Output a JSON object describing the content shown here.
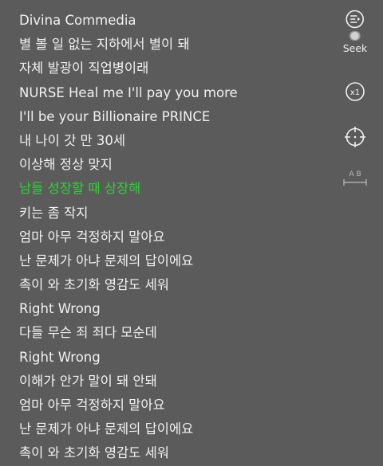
{
  "lyrics": {
    "current_index": 7,
    "lines": [
      "Divina Commedia",
      "별 볼 일 없는 지하에서 별이 돼",
      "자체 발광이 직업병이래",
      "NURSE Heal me I'll pay you more",
      "I'll be your Billionaire PRINCE",
      "내 나이 갓 만 30세",
      "이상해 정상 맞지",
      "남들 성장할 때 상장해",
      "키는 좀 작지",
      "엄마 아무 걱정하지 말아요",
      "난 문제가 아냐 문제의 답이에요",
      "촉이 와 초기화 영감도 세워",
      "Right Wrong",
      "다들 무슨 죄 죄다 모순데",
      "Right Wrong",
      "이해가 안가 말이 돼 안돼",
      "엄마 아무 걱정하지 말아요",
      "난 문제가 아냐 문제의 답이에요",
      "촉이 와 초기화 영감도 세워"
    ]
  },
  "controls": {
    "seek": {
      "label": "Seek",
      "icon": "seek-toggle-icon"
    },
    "speed": {
      "label": "x1",
      "icon": "speed-icon"
    },
    "locate": {
      "icon": "crosshair-icon"
    },
    "ab_repeat": {
      "label": "AB",
      "icon": "ab-repeat-icon"
    }
  },
  "colors": {
    "background": "#5b5b5b",
    "text": "#f1f1f1",
    "highlight": "#2fd23a",
    "icon": "#f1f1f1",
    "icon_muted": "#bdbdbd"
  }
}
